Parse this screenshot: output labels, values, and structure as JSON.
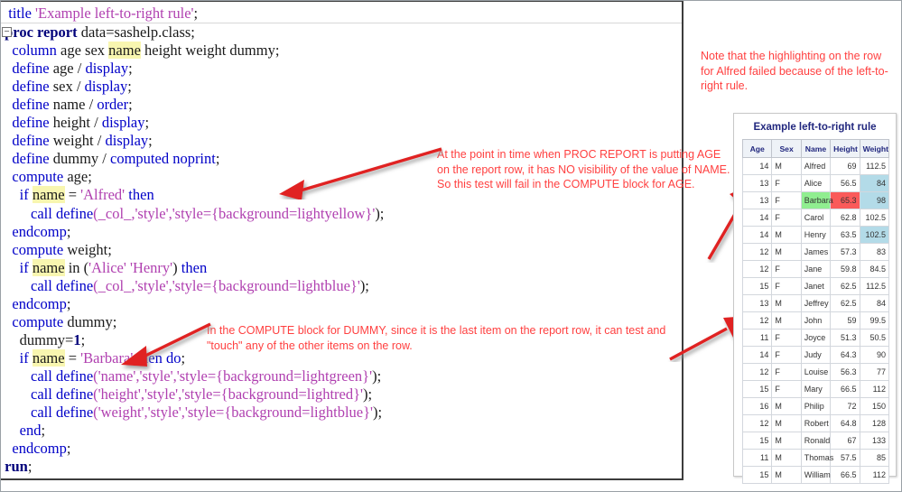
{
  "editor": {
    "fold_marker": "−",
    "lines": [
      {
        "id": "l1",
        "tokens": [
          {
            "t": "  ",
            "c": "plain"
          },
          {
            "t": "title",
            "c": "kw"
          },
          {
            "t": " ",
            "c": "plain"
          },
          {
            "t": "'Example left-to-right rule'",
            "c": "str"
          },
          {
            "t": ";",
            "c": "plain"
          }
        ],
        "sep": true
      },
      {
        "id": "l2",
        "fold": true,
        "tokens": [
          {
            "t": " ",
            "c": "plain"
          },
          {
            "t": "proc report",
            "c": "kwb"
          },
          {
            "t": " data=sashelp.class;",
            "c": "plain"
          }
        ]
      },
      {
        "id": "l3",
        "tokens": [
          {
            "t": "   ",
            "c": "plain"
          },
          {
            "t": "column",
            "c": "kw"
          },
          {
            "t": " age sex ",
            "c": "plain"
          },
          {
            "t": "name",
            "c": "plain hl"
          },
          {
            "t": " height weight dummy;",
            "c": "plain"
          }
        ]
      },
      {
        "id": "l4",
        "tokens": [
          {
            "t": "   ",
            "c": "plain"
          },
          {
            "t": "define",
            "c": "kw"
          },
          {
            "t": " age / ",
            "c": "plain"
          },
          {
            "t": "display",
            "c": "kw"
          },
          {
            "t": ";",
            "c": "plain"
          }
        ]
      },
      {
        "id": "l5",
        "tokens": [
          {
            "t": "   ",
            "c": "plain"
          },
          {
            "t": "define",
            "c": "kw"
          },
          {
            "t": " sex / ",
            "c": "plain"
          },
          {
            "t": "display",
            "c": "kw"
          },
          {
            "t": ";",
            "c": "plain"
          }
        ]
      },
      {
        "id": "l6",
        "tokens": [
          {
            "t": "   ",
            "c": "plain"
          },
          {
            "t": "define",
            "c": "kw"
          },
          {
            "t": " name / ",
            "c": "plain"
          },
          {
            "t": "order",
            "c": "kw"
          },
          {
            "t": ";",
            "c": "plain"
          }
        ]
      },
      {
        "id": "l7",
        "tokens": [
          {
            "t": "   ",
            "c": "plain"
          },
          {
            "t": "define",
            "c": "kw"
          },
          {
            "t": " height / ",
            "c": "plain"
          },
          {
            "t": "display",
            "c": "kw"
          },
          {
            "t": ";",
            "c": "plain"
          }
        ]
      },
      {
        "id": "l8",
        "tokens": [
          {
            "t": "   ",
            "c": "plain"
          },
          {
            "t": "define",
            "c": "kw"
          },
          {
            "t": " weight / ",
            "c": "plain"
          },
          {
            "t": "display",
            "c": "kw"
          },
          {
            "t": ";",
            "c": "plain"
          }
        ]
      },
      {
        "id": "l9",
        "tokens": [
          {
            "t": "   ",
            "c": "plain"
          },
          {
            "t": "define",
            "c": "kw"
          },
          {
            "t": " dummy / ",
            "c": "plain"
          },
          {
            "t": "computed noprint",
            "c": "kw"
          },
          {
            "t": ";",
            "c": "plain"
          }
        ]
      },
      {
        "id": "l10",
        "tokens": [
          {
            "t": "   ",
            "c": "plain"
          },
          {
            "t": "compute",
            "c": "kw"
          },
          {
            "t": " age;",
            "c": "plain"
          }
        ]
      },
      {
        "id": "l11",
        "tokens": [
          {
            "t": "     ",
            "c": "plain"
          },
          {
            "t": "if",
            "c": "kw"
          },
          {
            "t": " ",
            "c": "plain"
          },
          {
            "t": "name",
            "c": "plain hl"
          },
          {
            "t": " = ",
            "c": "plain"
          },
          {
            "t": "'Alfred'",
            "c": "str"
          },
          {
            "t": " ",
            "c": "plain"
          },
          {
            "t": "then",
            "c": "kw"
          }
        ]
      },
      {
        "id": "l12",
        "tokens": [
          {
            "t": "        ",
            "c": "plain"
          },
          {
            "t": "call define",
            "c": "kw"
          },
          {
            "t": "(_col_,",
            "c": "str"
          },
          {
            "t": "'style'",
            "c": "str"
          },
          {
            "t": ",",
            "c": "str"
          },
          {
            "t": "'style={background=lightyellow}'",
            "c": "str"
          },
          {
            "t": ");",
            "c": "plain"
          }
        ]
      },
      {
        "id": "l13",
        "tokens": [
          {
            "t": "   ",
            "c": "plain"
          },
          {
            "t": "endcomp",
            "c": "kw"
          },
          {
            "t": ";",
            "c": "plain"
          }
        ]
      },
      {
        "id": "l14",
        "tokens": [
          {
            "t": "   ",
            "c": "plain"
          },
          {
            "t": "compute",
            "c": "kw"
          },
          {
            "t": " weight;",
            "c": "plain"
          }
        ]
      },
      {
        "id": "l15",
        "tokens": [
          {
            "t": "     ",
            "c": "plain"
          },
          {
            "t": "if",
            "c": "kw"
          },
          {
            "t": " ",
            "c": "plain"
          },
          {
            "t": "name",
            "c": "plain hl"
          },
          {
            "t": " in (",
            "c": "plain"
          },
          {
            "t": "'Alice' 'Henry'",
            "c": "str"
          },
          {
            "t": ") ",
            "c": "plain"
          },
          {
            "t": "then",
            "c": "kw"
          }
        ]
      },
      {
        "id": "l16",
        "tokens": [
          {
            "t": "        ",
            "c": "plain"
          },
          {
            "t": "call define",
            "c": "kw"
          },
          {
            "t": "(_col_,",
            "c": "str"
          },
          {
            "t": "'style'",
            "c": "str"
          },
          {
            "t": ",",
            "c": "str"
          },
          {
            "t": "'style={background=lightblue}'",
            "c": "str"
          },
          {
            "t": ");",
            "c": "plain"
          }
        ]
      },
      {
        "id": "l17",
        "tokens": [
          {
            "t": "   ",
            "c": "plain"
          },
          {
            "t": "endcomp",
            "c": "kw"
          },
          {
            "t": ";",
            "c": "plain"
          }
        ]
      },
      {
        "id": "l18",
        "tokens": [
          {
            "t": "   ",
            "c": "plain"
          },
          {
            "t": "compute",
            "c": "kw"
          },
          {
            "t": " dummy;",
            "c": "plain"
          }
        ]
      },
      {
        "id": "l19",
        "tokens": [
          {
            "t": "     dummy=",
            "c": "plain"
          },
          {
            "t": "1",
            "c": "kwb"
          },
          {
            "t": ";",
            "c": "plain"
          }
        ]
      },
      {
        "id": "l20",
        "tokens": [
          {
            "t": "     ",
            "c": "plain"
          },
          {
            "t": "if",
            "c": "kw"
          },
          {
            "t": " ",
            "c": "plain"
          },
          {
            "t": "name",
            "c": "plain hl"
          },
          {
            "t": " = ",
            "c": "plain"
          },
          {
            "t": "'Barbara'",
            "c": "str"
          },
          {
            "t": " ",
            "c": "plain"
          },
          {
            "t": "then do",
            "c": "kw"
          },
          {
            "t": ";",
            "c": "plain"
          }
        ]
      },
      {
        "id": "l21",
        "tokens": [
          {
            "t": "        ",
            "c": "plain"
          },
          {
            "t": "call define",
            "c": "kw"
          },
          {
            "t": "(",
            "c": "str"
          },
          {
            "t": "'name'",
            "c": "str"
          },
          {
            "t": ",",
            "c": "str"
          },
          {
            "t": "'style'",
            "c": "str"
          },
          {
            "t": ",",
            "c": "str"
          },
          {
            "t": "'style={background=lightgreen}'",
            "c": "str"
          },
          {
            "t": ");",
            "c": "plain"
          }
        ]
      },
      {
        "id": "l22",
        "tokens": [
          {
            "t": "        ",
            "c": "plain"
          },
          {
            "t": "call define",
            "c": "kw"
          },
          {
            "t": "(",
            "c": "str"
          },
          {
            "t": "'height'",
            "c": "str"
          },
          {
            "t": ",",
            "c": "str"
          },
          {
            "t": "'style'",
            "c": "str"
          },
          {
            "t": ",",
            "c": "str"
          },
          {
            "t": "'style={background=lightred}'",
            "c": "str"
          },
          {
            "t": ");",
            "c": "plain"
          }
        ]
      },
      {
        "id": "l23",
        "tokens": [
          {
            "t": "        ",
            "c": "plain"
          },
          {
            "t": "call define",
            "c": "kw"
          },
          {
            "t": "(",
            "c": "str"
          },
          {
            "t": "'weight'",
            "c": "str"
          },
          {
            "t": ",",
            "c": "str"
          },
          {
            "t": "'style'",
            "c": "str"
          },
          {
            "t": ",",
            "c": "str"
          },
          {
            "t": "'style={background=lightblue}'",
            "c": "str"
          },
          {
            "t": ");",
            "c": "plain"
          }
        ]
      },
      {
        "id": "l24",
        "tokens": [
          {
            "t": "     ",
            "c": "plain"
          },
          {
            "t": "end",
            "c": "kw"
          },
          {
            "t": ";",
            "c": "plain"
          }
        ]
      },
      {
        "id": "l25",
        "tokens": [
          {
            "t": "   ",
            "c": "plain"
          },
          {
            "t": "endcomp",
            "c": "kw"
          },
          {
            "t": ";",
            "c": "plain"
          }
        ]
      },
      {
        "id": "l26",
        "tokens": [
          {
            "t": " ",
            "c": "plain"
          },
          {
            "t": "run",
            "c": "kwb"
          },
          {
            "t": ";",
            "c": "plain"
          }
        ]
      }
    ]
  },
  "annotations": {
    "top": "Note that the highlighting on the row for Alfred failed because of the left-to-right rule.",
    "age": "At the point in time when PROC REPORT is putting AGE on the report row, it has NO visibility of the value of NAME. So this test will fail in the COMPUTE block for AGE.",
    "dummy": "In the COMPUTE block for DUMMY, since it is the last item on the report row, it can test and \"touch\" any of the other items on the row.",
    "color": "#ff4040"
  },
  "report": {
    "title": "Example left-to-right rule",
    "columns": [
      "Age",
      "Sex",
      "Name",
      "Height",
      "Weight"
    ],
    "rows": [
      {
        "age": "14",
        "sex": "M",
        "name": "Alfred",
        "height": "69",
        "weight": "112.5",
        "hl": {}
      },
      {
        "age": "13",
        "sex": "F",
        "name": "Alice",
        "height": "56.5",
        "weight": "84",
        "hl": {
          "weight": "bg-lightblue"
        }
      },
      {
        "age": "13",
        "sex": "F",
        "name": "Barbara",
        "height": "65.3",
        "weight": "98",
        "hl": {
          "name": "bg-lightgreen",
          "height": "bg-lightred",
          "weight": "bg-lightblue"
        }
      },
      {
        "age": "14",
        "sex": "F",
        "name": "Carol",
        "height": "62.8",
        "weight": "102.5",
        "hl": {}
      },
      {
        "age": "14",
        "sex": "M",
        "name": "Henry",
        "height": "63.5",
        "weight": "102.5",
        "hl": {
          "weight": "bg-lightblue"
        }
      },
      {
        "age": "12",
        "sex": "M",
        "name": "James",
        "height": "57.3",
        "weight": "83",
        "hl": {}
      },
      {
        "age": "12",
        "sex": "F",
        "name": "Jane",
        "height": "59.8",
        "weight": "84.5",
        "hl": {}
      },
      {
        "age": "15",
        "sex": "F",
        "name": "Janet",
        "height": "62.5",
        "weight": "112.5",
        "hl": {}
      },
      {
        "age": "13",
        "sex": "M",
        "name": "Jeffrey",
        "height": "62.5",
        "weight": "84",
        "hl": {}
      },
      {
        "age": "12",
        "sex": "M",
        "name": "John",
        "height": "59",
        "weight": "99.5",
        "hl": {}
      },
      {
        "age": "11",
        "sex": "F",
        "name": "Joyce",
        "height": "51.3",
        "weight": "50.5",
        "hl": {}
      },
      {
        "age": "14",
        "sex": "F",
        "name": "Judy",
        "height": "64.3",
        "weight": "90",
        "hl": {}
      },
      {
        "age": "12",
        "sex": "F",
        "name": "Louise",
        "height": "56.3",
        "weight": "77",
        "hl": {}
      },
      {
        "age": "15",
        "sex": "F",
        "name": "Mary",
        "height": "66.5",
        "weight": "112",
        "hl": {}
      },
      {
        "age": "16",
        "sex": "M",
        "name": "Philip",
        "height": "72",
        "weight": "150",
        "hl": {}
      },
      {
        "age": "12",
        "sex": "M",
        "name": "Robert",
        "height": "64.8",
        "weight": "128",
        "hl": {}
      },
      {
        "age": "15",
        "sex": "M",
        "name": "Ronald",
        "height": "67",
        "weight": "133",
        "hl": {}
      },
      {
        "age": "11",
        "sex": "M",
        "name": "Thomas",
        "height": "57.5",
        "weight": "85",
        "hl": {}
      },
      {
        "age": "15",
        "sex": "M",
        "name": "William",
        "height": "66.5",
        "weight": "112",
        "hl": {}
      }
    ]
  }
}
